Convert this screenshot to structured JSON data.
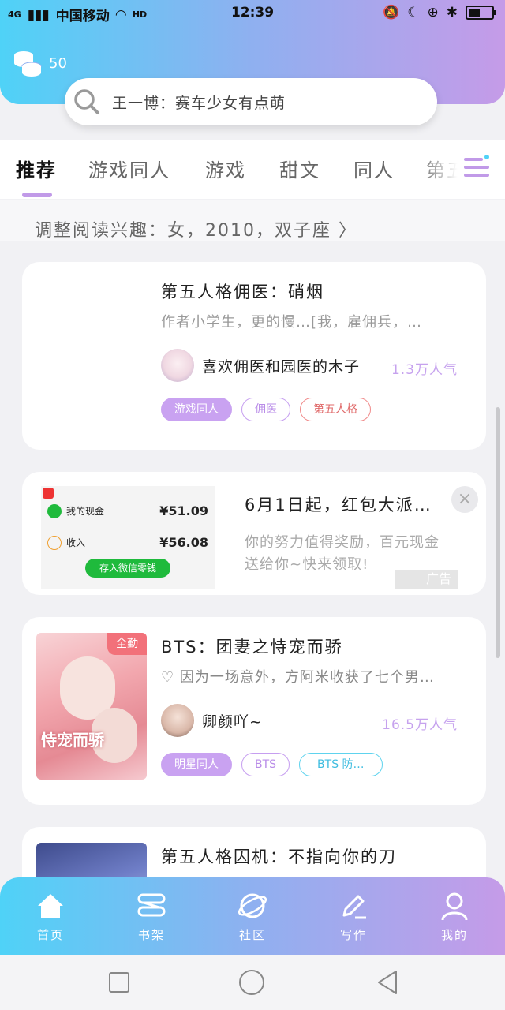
{
  "status_bar": {
    "network": "4G",
    "carrier": "中国移动",
    "hd": "HD",
    "time": "12:39"
  },
  "header": {
    "coins": "50",
    "search_placeholder": "王一博：赛车少女有点萌"
  },
  "tabs": [
    {
      "label": "推荐",
      "active": true
    },
    {
      "label": "游戏同人"
    },
    {
      "label": "游戏"
    },
    {
      "label": "甜文"
    },
    {
      "label": "同人"
    },
    {
      "label": "第五"
    }
  ],
  "interest": {
    "text": "调整阅读兴趣：女，2010，双子座 〉"
  },
  "cards": [
    {
      "title": "第五人格佣医：硝烟",
      "desc": "作者小学生，更的慢…[我，雇佣兵，…",
      "author": "喜欢佣医和园医的木子",
      "popularity": "1.3万人气",
      "tags": [
        "游戏同人",
        "佣医",
        "第五人格"
      ]
    },
    {
      "badge": "全勤",
      "title": "BTS：团妻之恃宠而骄",
      "desc": "♡ 因为一场意外，方阿米收获了七个男…",
      "author": "卿颜吖~",
      "popularity": "16.5万人气",
      "tags": [
        "明星同人",
        "BTS",
        "BTS 防…"
      ],
      "cover_text": "恃宠而骄"
    },
    {
      "title": "第五人格囚机：不指向你的刀"
    }
  ],
  "ad": {
    "title": "6月1日起，红包大派…",
    "desc": "你的努力值得奖励，百元现金送给你~快来领取!",
    "label": "广告",
    "close": "×",
    "image": {
      "row1_label": "我的现金",
      "row1_amount": "¥51.09",
      "row2_label": "收入",
      "row2_amount": "¥56.08",
      "button": "存入微信零钱"
    }
  },
  "bottom_nav": [
    {
      "label": "首页",
      "icon": "home-icon"
    },
    {
      "label": "书架",
      "icon": "bookshelf-icon"
    },
    {
      "label": "社区",
      "icon": "planet-icon"
    },
    {
      "label": "写作",
      "icon": "pen-icon"
    },
    {
      "label": "我的",
      "icon": "user-icon"
    }
  ],
  "colors": {
    "gradient_start": "#4fd2f7",
    "gradient_end": "#c59be8",
    "accent_purple": "#c9a2f1",
    "popularity": "#c6a2ee"
  }
}
